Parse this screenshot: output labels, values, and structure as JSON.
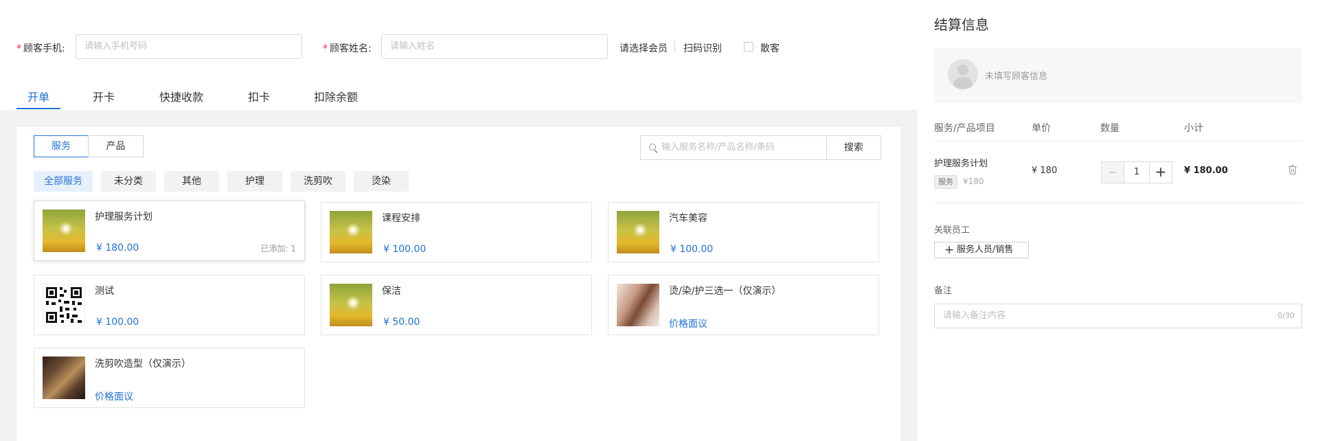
{
  "customer_form": {
    "phone_label": "顾客手机:",
    "phone_placeholder": "请输入手机号码",
    "name_label": "顾客姓名:",
    "name_placeholder": "请输入姓名",
    "select_member": "请选择会员",
    "scan": "扫码识别",
    "walkin": "散客"
  },
  "tabs": [
    "开单",
    "开卡",
    "快捷收款",
    "扣卡",
    "扣除余额"
  ],
  "active_tab": "开单",
  "type_toggle": {
    "service": "服务",
    "product": "产品"
  },
  "search": {
    "placeholder": "输入服务名称/产品名称/条码",
    "button": "搜索"
  },
  "categories": [
    "全部服务",
    "未分类",
    "其他",
    "护理",
    "洗剪吹",
    "烫染"
  ],
  "items": [
    {
      "title": "护理服务计划",
      "price": "¥ 180.00",
      "added": "已添加: 1",
      "thumb": "flower"
    },
    {
      "title": "课程安排",
      "price": "¥ 100.00",
      "thumb": "flower"
    },
    {
      "title": "汽车美容",
      "price": "¥ 100.00",
      "thumb": "flower"
    },
    {
      "title": "测试",
      "price": "¥ 100.00",
      "thumb": "qr-code"
    },
    {
      "title": "保洁",
      "price": "¥ 50.00",
      "thumb": "flower"
    },
    {
      "title": "烫/染/护三选一（仅演示）",
      "price": "价格面议",
      "thumb": "hair-photo"
    },
    {
      "title": "洗剪吹造型（仅演示）",
      "price": "价格面议",
      "thumb": "hair-photo"
    }
  ],
  "checkout": {
    "title": "结算信息",
    "customer_placeholder": "未填写顾客信息",
    "headers": {
      "item": "服务/产品项目",
      "price": "单价",
      "qty": "数量",
      "subtotal": "小计"
    },
    "line": {
      "name": "护理服务计划",
      "tag": "服务",
      "orig_price": "¥180",
      "unit_price": "¥ 180",
      "qty": "1",
      "subtotal": "¥ 180.00"
    },
    "staff_label": "关联员工",
    "staff_button": "服务人员/销售",
    "remark_label": "备注",
    "remark_placeholder": "请输入备注内容",
    "remark_count": "0/30"
  },
  "colors": {
    "accent": "#1f6fd6",
    "required": "#f5222d"
  }
}
